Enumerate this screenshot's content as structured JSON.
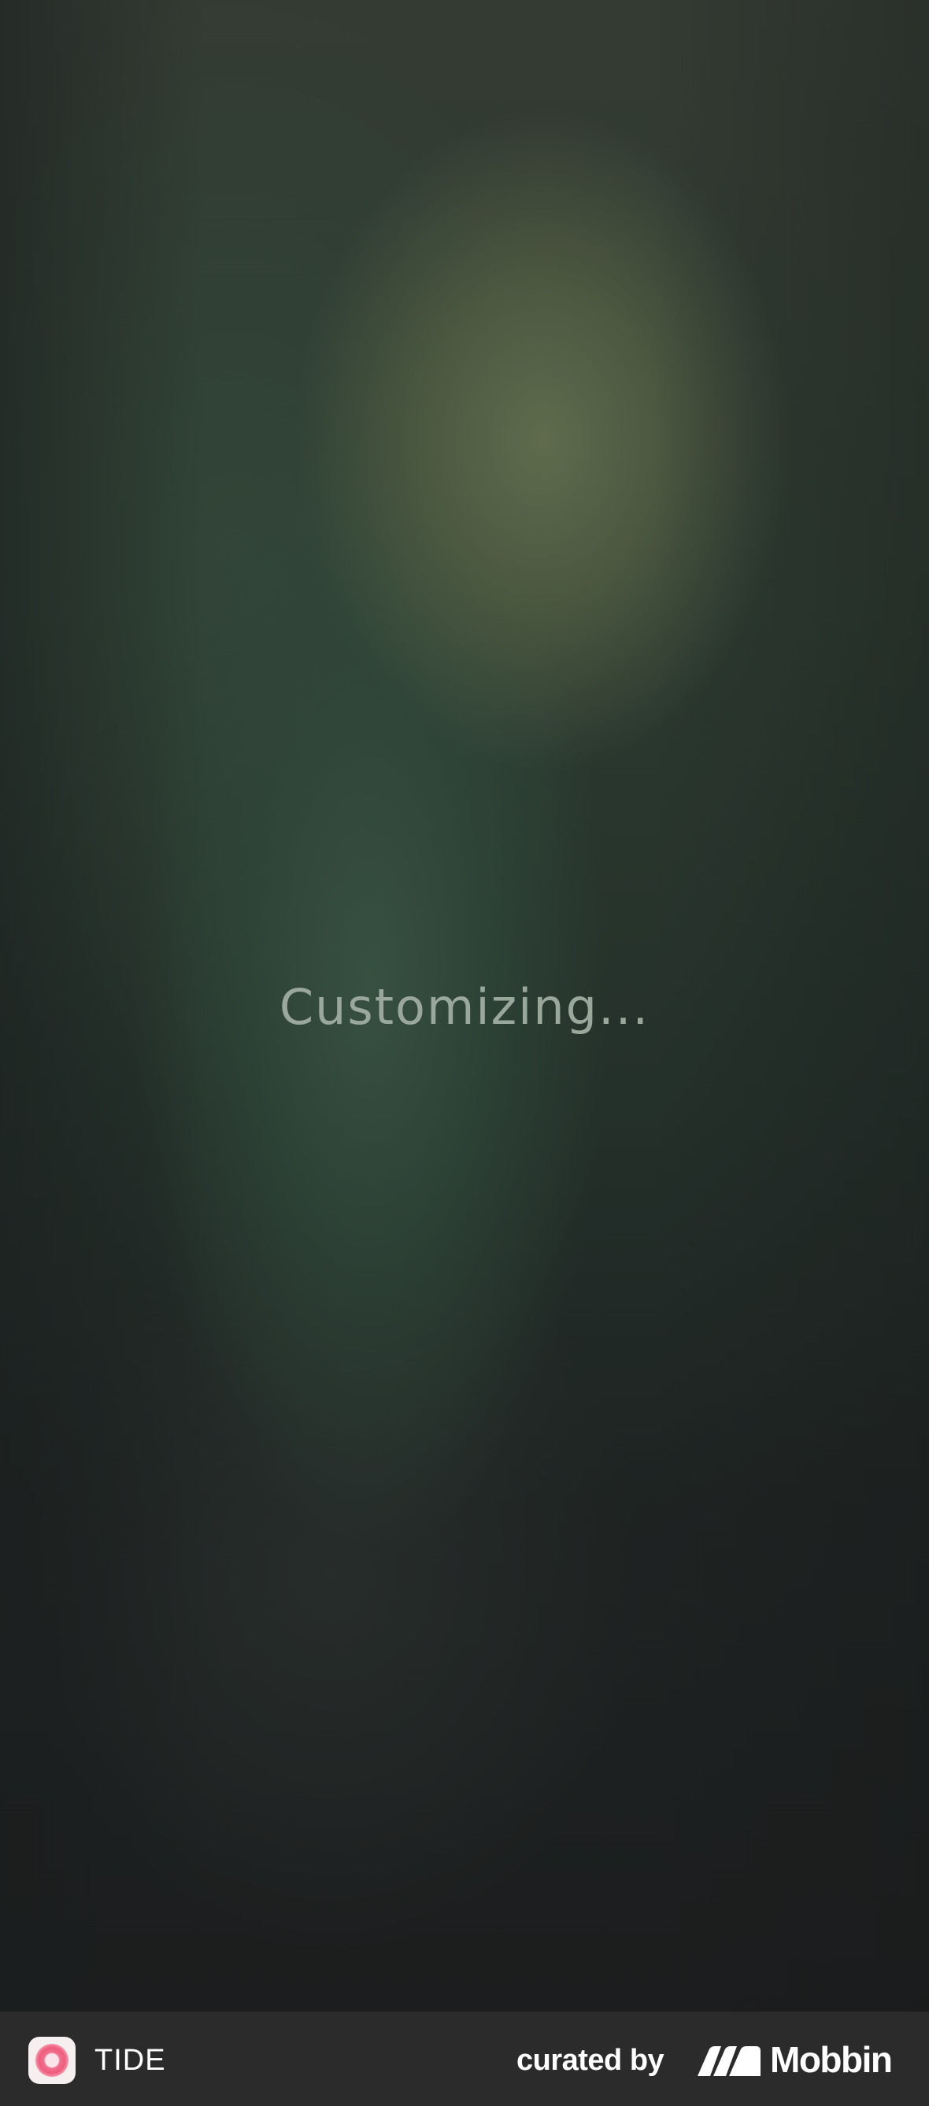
{
  "screen": {
    "status_text": "Customizing..."
  },
  "footer": {
    "app_name": "TIDE",
    "curated_label": "curated by",
    "brand_name": "Mobbin",
    "icons": {
      "app": "tide-app-icon",
      "brand": "mobbin-logo-icon"
    },
    "colors": {
      "bar": "#2b2b2c",
      "text": "#ffffff",
      "app_icon_accent": "#ef5c7d"
    }
  },
  "colors": {
    "status_text": "#9aa89c",
    "background_top": "#5c6a4c",
    "background_mid": "#35503f",
    "background_bottom": "#1c1d1e"
  }
}
